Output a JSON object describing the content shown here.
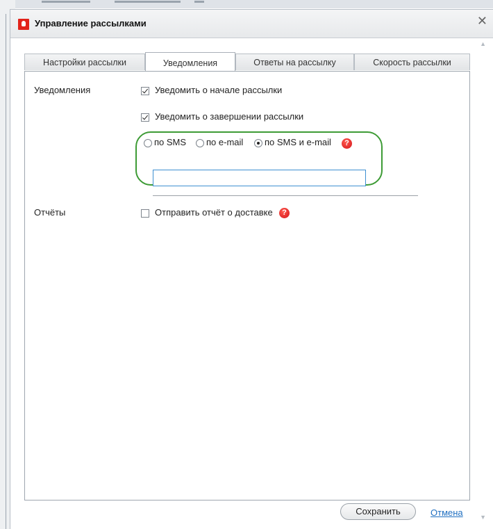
{
  "dialog": {
    "title": "Управление рассылками"
  },
  "tabs": [
    {
      "label": "Настройки рассылки",
      "active": false
    },
    {
      "label": "Уведомления",
      "active": true
    },
    {
      "label": "Ответы на рассылку",
      "active": false
    },
    {
      "label": "Скорость рассылки",
      "active": false
    }
  ],
  "notifications": {
    "section_label": "Уведомления",
    "notify_start": {
      "label": "Уведомить о начале рассылки",
      "checked": true
    },
    "notify_end": {
      "label": "Уведомить о завершении рассылки",
      "checked": true
    },
    "channel_options": [
      {
        "label": "по SMS",
        "selected": false
      },
      {
        "label": "по e-mail",
        "selected": false
      },
      {
        "label": "по SMS и e-mail",
        "selected": true
      }
    ],
    "contact_input_value": ""
  },
  "reports": {
    "section_label": "Отчёты",
    "delivery_report": {
      "label": "Отправить отчёт о доставке",
      "checked": false
    }
  },
  "footer": {
    "save_label": "Сохранить",
    "cancel_label": "Отмена"
  },
  "icons": {
    "close": "close-icon",
    "help": "question-icon",
    "logo": "vodafone-logo"
  },
  "colors": {
    "highlight_outline": "#3d9b35",
    "help_icon": "#d4141a",
    "link": "#1f6fc1",
    "input_border": "#3d8fd1"
  }
}
